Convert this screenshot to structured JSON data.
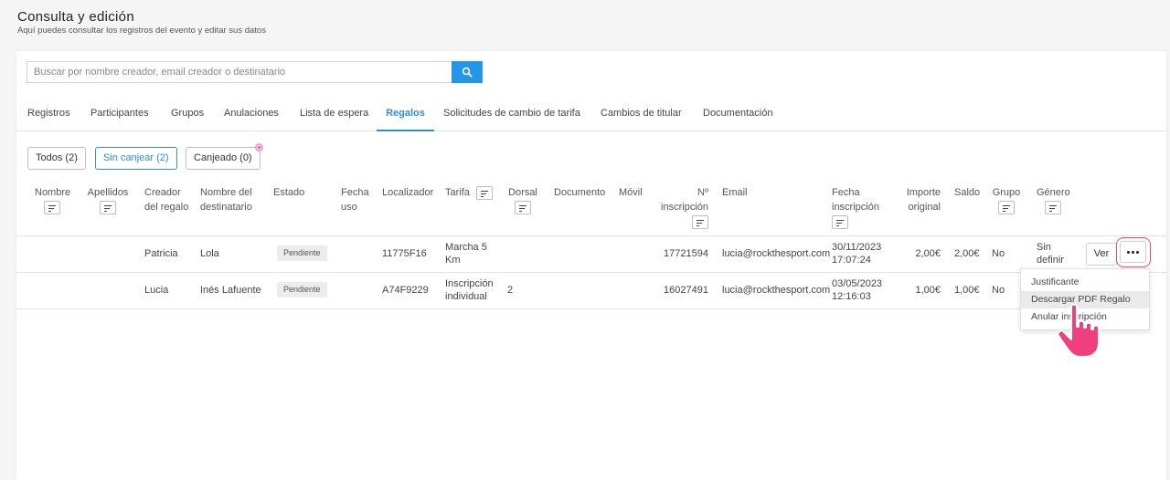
{
  "header": {
    "title": "Consulta y edición",
    "subtitle": "Aquí puedes consultar los registros del evento y editar sus datos"
  },
  "search": {
    "placeholder": "Buscar por nombre creador, email creador o destinatario",
    "icon": "search-icon"
  },
  "tabs": [
    {
      "label": "Registros"
    },
    {
      "label": "Participantes"
    },
    {
      "label": "Grupos"
    },
    {
      "label": "Anulaciones"
    },
    {
      "label": "Lista de espera"
    },
    {
      "label": "Regalos",
      "active": true
    },
    {
      "label": "Solicitudes de cambio de tarifa"
    },
    {
      "label": "Cambios de titular"
    },
    {
      "label": "Documentación"
    }
  ],
  "filters": [
    {
      "label": "Todos (2)"
    },
    {
      "label": "Sin canjear (2)",
      "active": true
    },
    {
      "label": "Canjeado (0)"
    }
  ],
  "columns": {
    "nombre": "Nombre",
    "apellidos": "Apellidos",
    "creador_1": "Creador",
    "creador_2": "del regalo",
    "destinatario_1": "Nombre del",
    "destinatario_2": "destinatario",
    "estado": "Estado",
    "fecha_uso_1": "Fecha",
    "fecha_uso_2": "uso",
    "localizador": "Localizador",
    "tarifa": "Tarifa",
    "dorsal": "Dorsal",
    "documento": "Documento",
    "movil": "Móvil",
    "inscripcion_1": "Nº",
    "inscripcion_2": "inscripción",
    "email": "Email",
    "fecha_insc_1": "Fecha",
    "fecha_insc_2": "inscripción",
    "importe_1": "Importe",
    "importe_2": "original",
    "saldo": "Saldo",
    "grupo": "Grupo",
    "genero": "Género"
  },
  "rows": [
    {
      "creador": "Patricia",
      "destinatario": "Lola",
      "estado": "Pendiente",
      "localizador": "11775F16",
      "tarifa_1": "Marcha 5",
      "tarifa_2": "Km",
      "dorsal": "",
      "inscripcion": "17721594",
      "email": "lucia@rockthesport.com",
      "fecha_1": "30/11/2023",
      "fecha_2": "17:07:24",
      "importe": "2,00€",
      "saldo": "2,00€",
      "grupo": "No",
      "genero_1": "Sin",
      "genero_2": "definir"
    },
    {
      "creador": "Lucia",
      "destinatario": "Inés Lafuente",
      "estado": "Pendiente",
      "localizador": "A74F9229",
      "tarifa_1": "Inscripción",
      "tarifa_2": "individual",
      "dorsal": "2",
      "inscripcion": "16027491",
      "email": "lucia@rockthesport.com",
      "fecha_1": "03/05/2023",
      "fecha_2": "12:16:03",
      "importe": "1,00€",
      "saldo": "1,00€",
      "grupo": "No"
    }
  ],
  "actions": {
    "ver_label": "Ver",
    "more_icon": "more-horizontal-icon"
  },
  "dropdown": {
    "items": [
      {
        "label": "Justificante"
      },
      {
        "label": "Descargar PDF Regalo",
        "hover": true
      },
      {
        "label": "Anular inscripción"
      }
    ]
  },
  "colors": {
    "accent": "#2d8ecf",
    "search_button": "#2496e8",
    "highlight": "#e5497f"
  }
}
